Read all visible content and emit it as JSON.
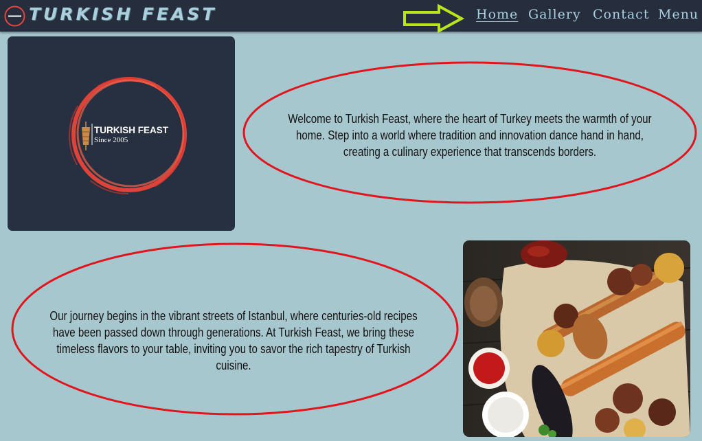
{
  "nav": {
    "brand_name": "Turkish Feast",
    "links": [
      "Home",
      "Gallery",
      "Contact",
      "Menu"
    ],
    "active_link": "Home"
  },
  "hero": {
    "logo_text": "TURKISH FEAST",
    "logo_since": "Since 2005",
    "intro": "Welcome to Turkish Feast, where the heart of Turkey meets the warmth of your home. Step into a world where tradition and innovation dance hand in hand, creating a culinary experience that transcends borders."
  },
  "story": {
    "text": "Our journey begins in the vibrant streets of Istanbul, where centuries-old recipes have been passed down through generations. At Turkish Feast, we bring these timeless flavors to your table, inviting you to savor the rich tapestry of Turkish cuisine."
  },
  "colors": {
    "navbar": "#262e3e",
    "page_background": "#a7c7cf",
    "nav_text": "#a9d0dc",
    "annotation_red": "#e0161e",
    "annotation_arrow": "#b9e51a"
  }
}
